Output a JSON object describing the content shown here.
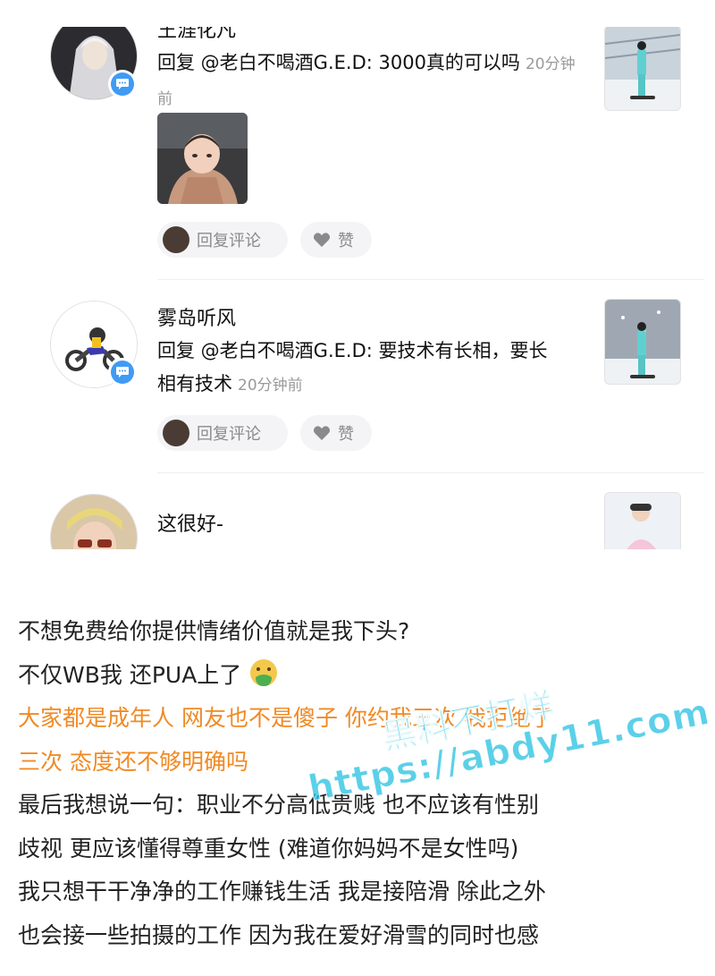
{
  "comments": [
    {
      "username": "王涯化凡",
      "text": "回复 @老白不喝酒G.E.D: 3000真的可以吗",
      "time": "20分钟前",
      "reply_label": "回复评论",
      "like_label": "赞"
    },
    {
      "username": "雾岛听风",
      "text": "回复 @老白不喝酒G.E.D: 要技术有长相，要长相有技术",
      "time": "20分钟前",
      "reply_label": "回复评论",
      "like_label": "赞"
    },
    {
      "username": "",
      "text": "这很好-"
    }
  ],
  "post": {
    "lines": [
      "不想免费给你提供情绪价值就是我下头?",
      "不仅WB我 还PUA上了",
      "大家都是成年人 网友也不是傻子 你约我三次 我拒绝了",
      "三次 态度还不够明确吗",
      "最后我想说一句：职业不分高低贵贱 也不应该有性别",
      "歧视 更应该懂得尊重女性 (难道你妈妈不是女性吗)",
      "我只想干干净净的工作赚钱生活 我是接陪滑 除此之外",
      "也会接一些拍摄的工作 因为我在爱好滑雪的同时也感"
    ],
    "emoji_icon": "nauseated-face-icon",
    "highlight_color": "#f08a24"
  },
  "watermark": {
    "line1": "黑料不打烊",
    "line2": "https://abdy11.com"
  },
  "colors": {
    "badge_blue": "#3f9bf5",
    "time_gray": "#9a9a9a",
    "pill_bg": "#f4f4f6"
  }
}
